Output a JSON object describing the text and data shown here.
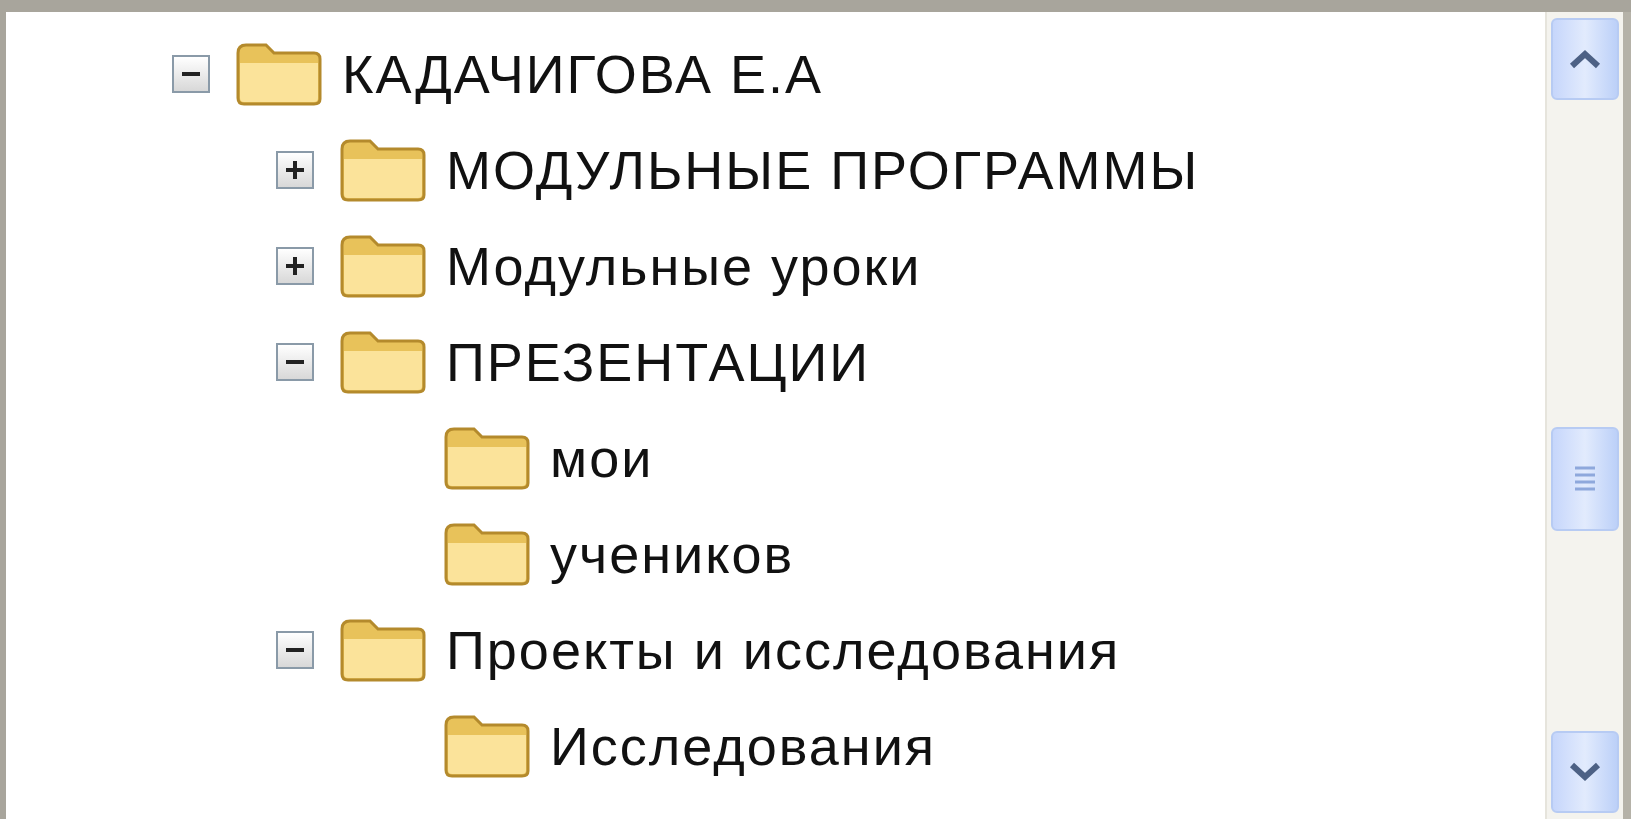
{
  "tree": [
    {
      "label": "КАДАЧИГОВА Е.А",
      "kind": "branch",
      "expanded": true,
      "children": [
        {
          "label": "МОДУЛЬНЫЕ ПРОГРАММЫ",
          "kind": "branch",
          "expanded": false
        },
        {
          "label": "Модульные уроки",
          "kind": "branch",
          "expanded": false
        },
        {
          "label": "ПРЕЗЕНТАЦИИ",
          "kind": "branch",
          "expanded": true,
          "children": [
            {
              "label": "мои",
              "kind": "leaf"
            },
            {
              "label": "учеников",
              "kind": "leaf"
            }
          ]
        },
        {
          "label": "Проекты и исследования",
          "kind": "branch",
          "expanded": true,
          "children": [
            {
              "label": "Исследования",
              "kind": "leaf"
            }
          ]
        }
      ]
    }
  ]
}
